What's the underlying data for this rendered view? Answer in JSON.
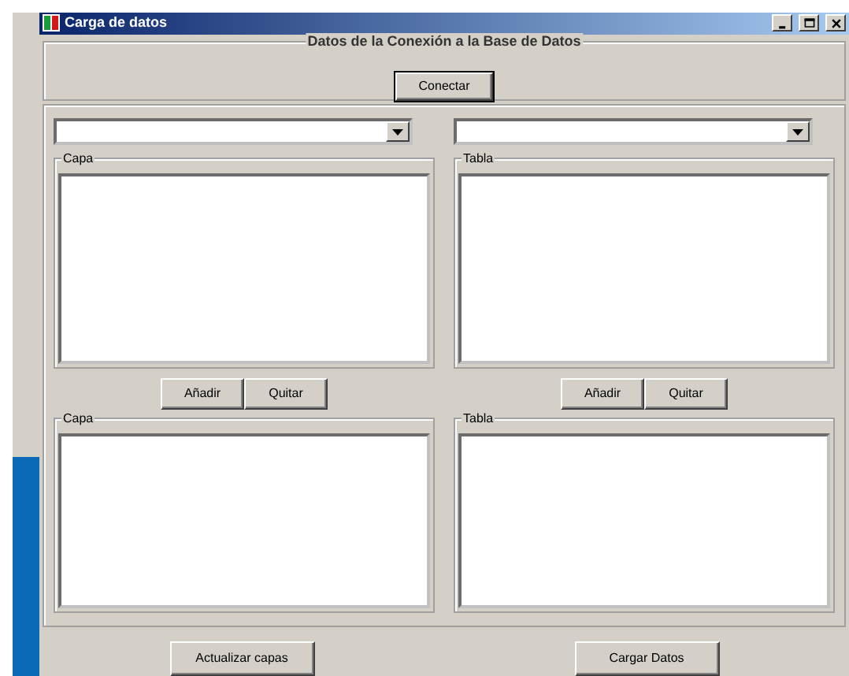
{
  "window": {
    "title": "Carga de datos",
    "controls": [
      {
        "kind": "minimize"
      },
      {
        "kind": "maximize"
      },
      {
        "kind": "close"
      }
    ]
  },
  "connection": {
    "title": "Datos de la Conexión a la Base de Datos",
    "button": "Conectar"
  },
  "columns": [
    {
      "upper_title": "Capa",
      "buttons": [
        "Añadir",
        "Quitar"
      ],
      "lower_title": "Capa"
    },
    {
      "upper_title": "Tabla",
      "buttons": [
        "Añadir",
        "Quitar"
      ],
      "lower_title": "Tabla"
    }
  ],
  "footer_buttons": [
    "Actualizar capas",
    "Cargar Datos"
  ]
}
